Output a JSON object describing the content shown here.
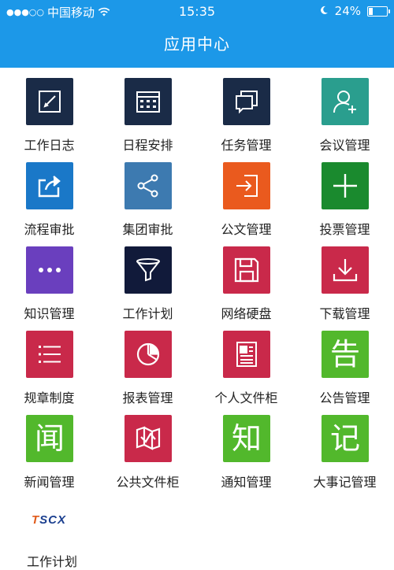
{
  "status_bar": {
    "carrier": "中国移动",
    "time": "15:35",
    "battery": "24%"
  },
  "header": {
    "title": "应用中心"
  },
  "apps": [
    {
      "label": "工作日志",
      "color": "#1a2b47",
      "icon": "edit-icon"
    },
    {
      "label": "日程安排",
      "color": "#1a2b47",
      "icon": "calendar-icon"
    },
    {
      "label": "任务管理",
      "color": "#1a2b47",
      "icon": "task-icon"
    },
    {
      "label": "会议管理",
      "color": "#2a9e8e",
      "icon": "add-user-icon"
    },
    {
      "label": "流程审批",
      "color": "#1a78c8",
      "icon": "share-out-icon"
    },
    {
      "label": "集团审批",
      "color": "#3d7ab0",
      "icon": "share-icon"
    },
    {
      "label": "公文管理",
      "color": "#ea5a1e",
      "icon": "login-icon"
    },
    {
      "label": "投票管理",
      "color": "#1a8a2e",
      "icon": "plus-icon"
    },
    {
      "label": "知识管理",
      "color": "#6a3fbe",
      "icon": "more-icon"
    },
    {
      "label": "工作计划",
      "color": "#111a3a",
      "icon": "funnel-icon"
    },
    {
      "label": "网络硬盘",
      "color": "#c9294a",
      "icon": "floppy-icon"
    },
    {
      "label": "下载管理",
      "color": "#c9294a",
      "icon": "download-icon"
    },
    {
      "label": "规章制度",
      "color": "#c9294a",
      "icon": "list-icon"
    },
    {
      "label": "报表管理",
      "color": "#c9294a",
      "icon": "pie-chart-icon"
    },
    {
      "label": "个人文件柜",
      "color": "#c9294a",
      "icon": "document-icon"
    },
    {
      "label": "公告管理",
      "color": "#52b82c",
      "icon": "char-icon",
      "char": "告"
    },
    {
      "label": "新闻管理",
      "color": "#52b82c",
      "icon": "char-icon",
      "char": "闻"
    },
    {
      "label": "公共文件柜",
      "color": "#c9294a",
      "icon": "map-icon"
    },
    {
      "label": "通知管理",
      "color": "#52b82c",
      "icon": "char-icon",
      "char": "知"
    },
    {
      "label": "大事记管理",
      "color": "#52b82c",
      "icon": "char-icon",
      "char": "记"
    }
  ],
  "footer": {
    "logo_t": "T",
    "logo_rest": "SCX",
    "partial_label": "工作计划"
  }
}
